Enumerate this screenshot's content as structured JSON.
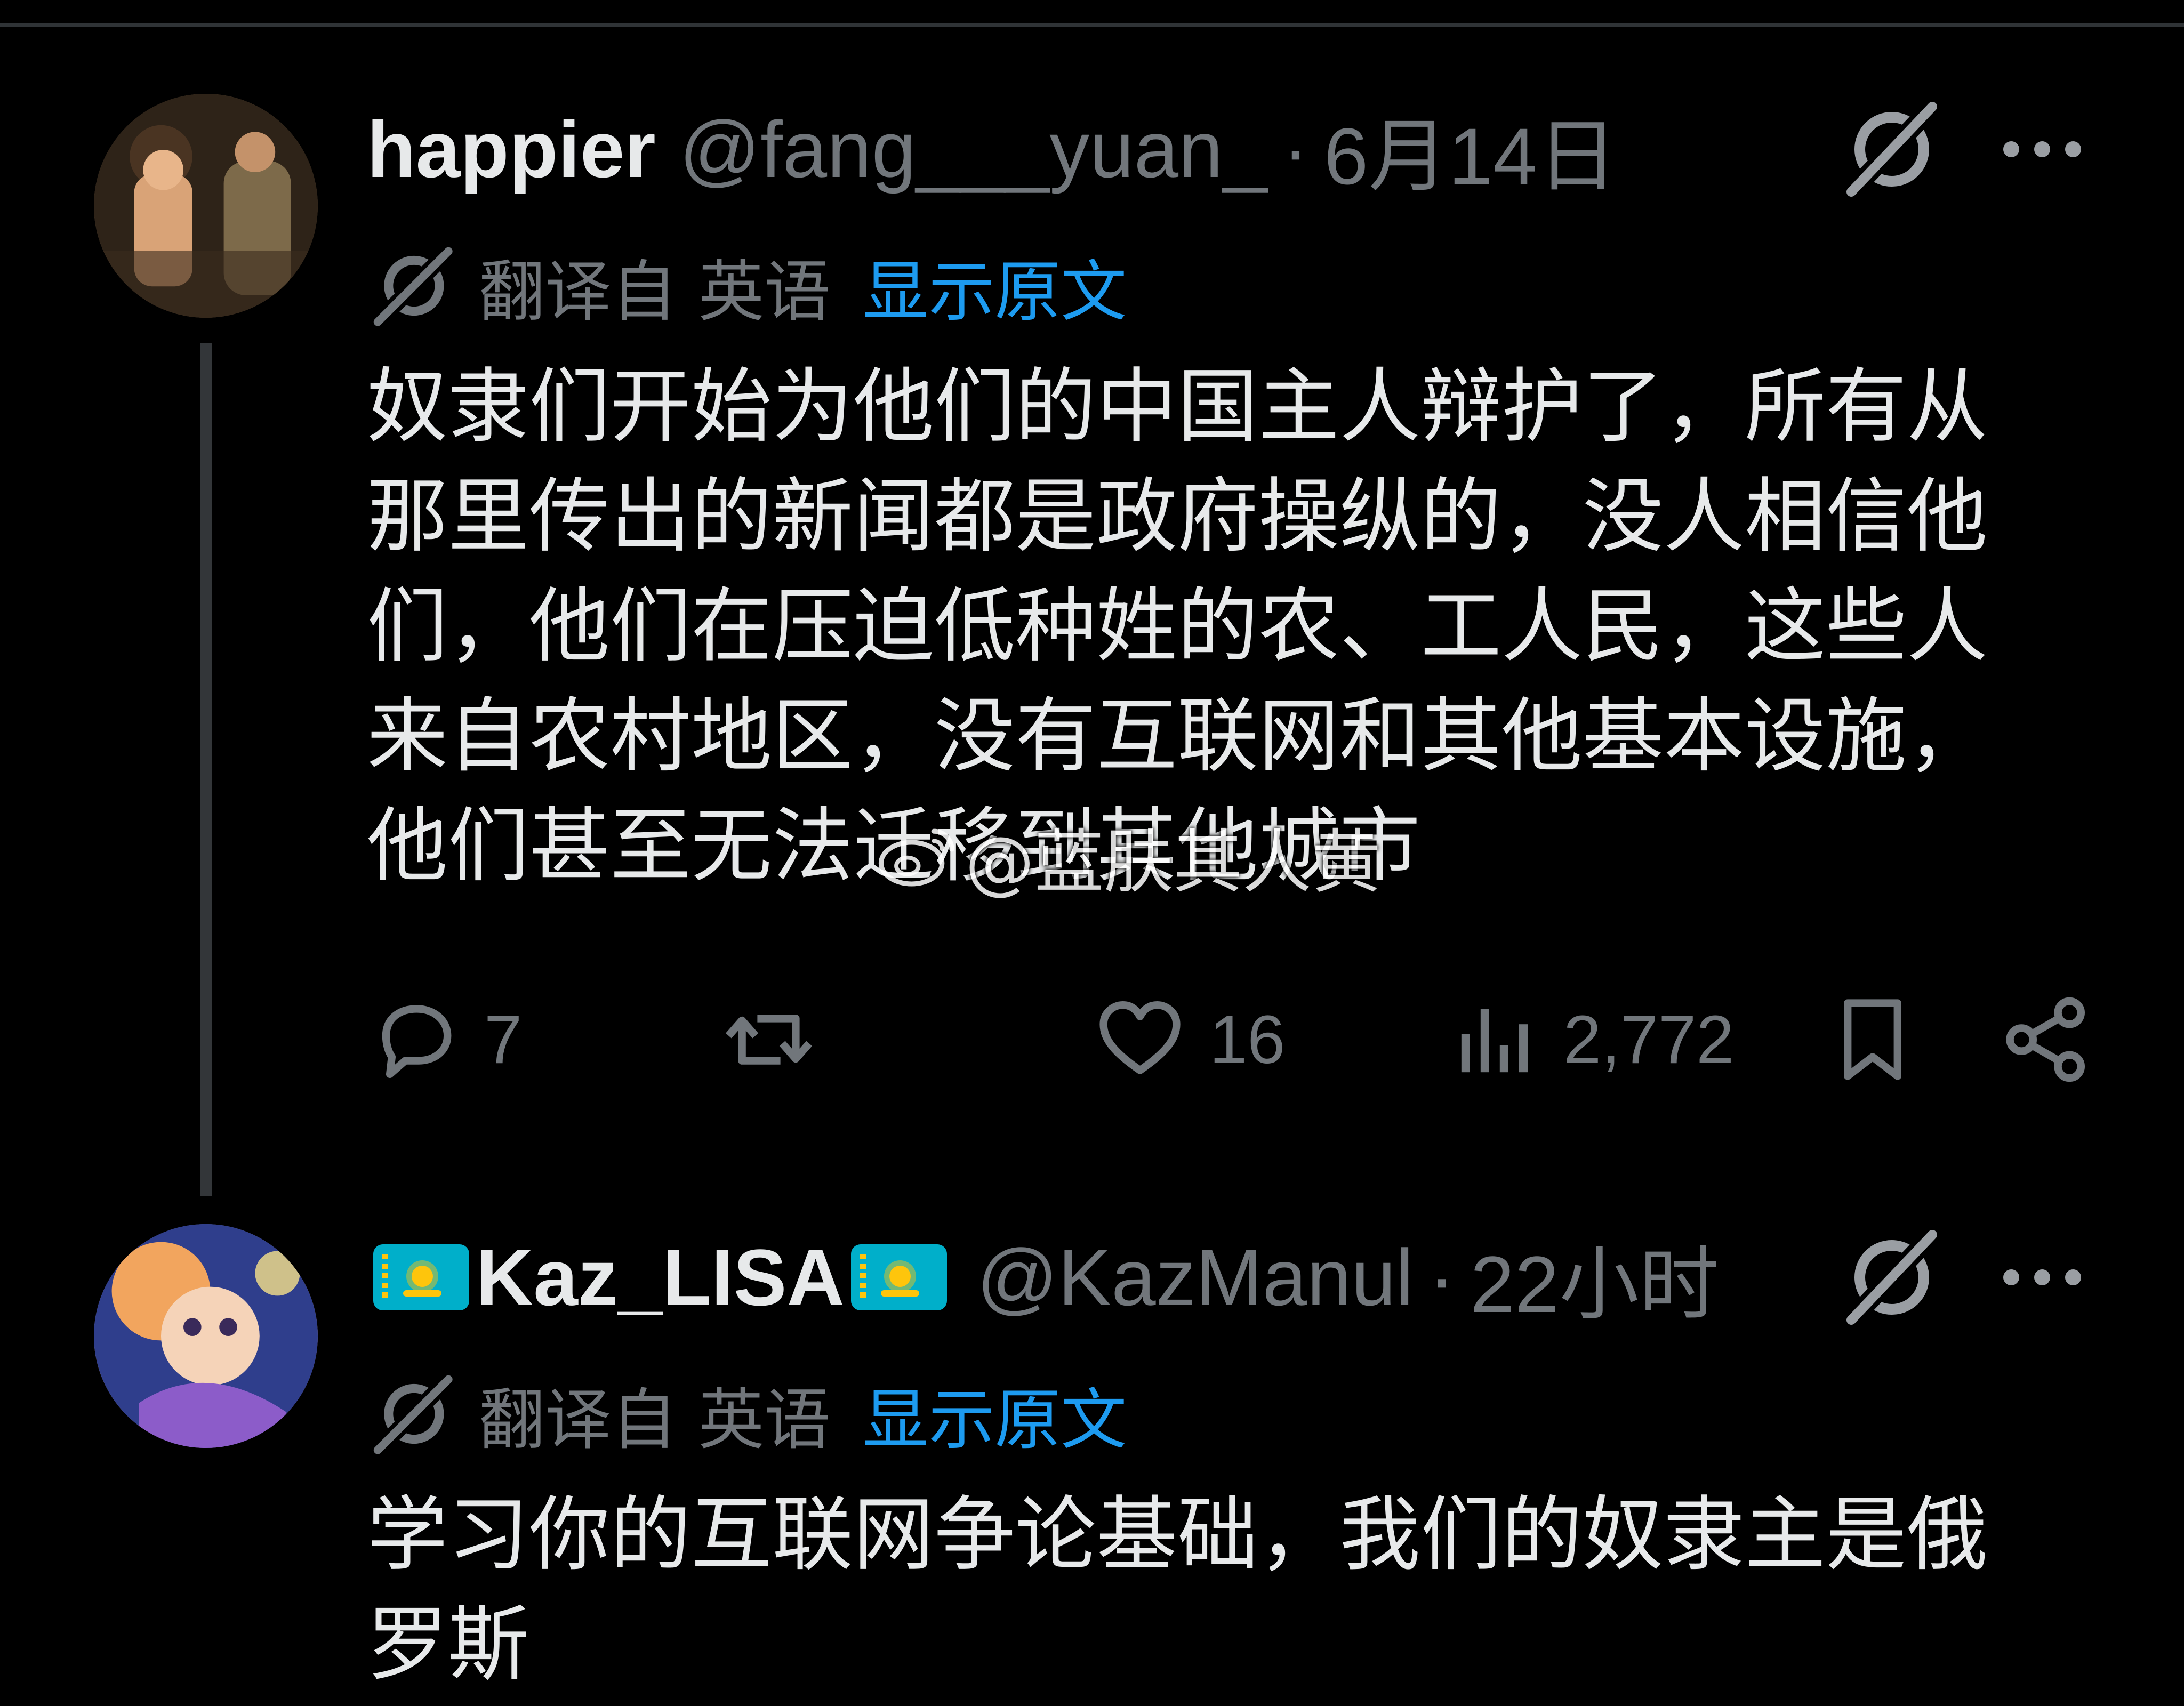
{
  "colors": {
    "background": "#000000",
    "primary_text": "#e7e9ea",
    "secondary_text": "#71767b",
    "link_blue": "#1d9bf0",
    "thread_line": "#333639"
  },
  "tweets": [
    {
      "display_name": "happier",
      "handle": "@fang___yuan_",
      "separator": "·",
      "time": "6月14日",
      "translated_label": "翻译自 英语",
      "show_original": "显示原文",
      "text": "奴隶们开始为他们的中国主人辩护了，所有从那里传出的新闻都是政府操纵的，没人相信他们，他们在压迫低种姓的农、工人民，这些人来自农村地区，没有互联网和其他基本设施，他们甚至无法迁移到其他城市",
      "actions": {
        "replies": "7",
        "retweets": "",
        "likes": "16",
        "views": "2,772"
      }
    },
    {
      "display_name": "Kaz_LISA",
      "handle": "@KazManul",
      "separator": "·",
      "time": "22小时",
      "translated_label": "翻译自 英语",
      "show_original": "显示原文",
      "text": "学习你的互联网争论基础，我们的奴隶主是俄罗斯"
    }
  ],
  "watermark": {
    "text": "@蓝肤其人黄",
    "icon": "weibo-logo-icon"
  },
  "icons": {
    "grok": "grok-icon",
    "more": "more-dots-icon",
    "translate": "grok-translate-icon",
    "reply": "reply-icon",
    "retweet": "retweet-icon",
    "like": "heart-icon",
    "views": "views-chart-icon",
    "bookmark": "bookmark-icon",
    "share": "share-icon",
    "flag": "kazakhstan-flag-icon"
  }
}
